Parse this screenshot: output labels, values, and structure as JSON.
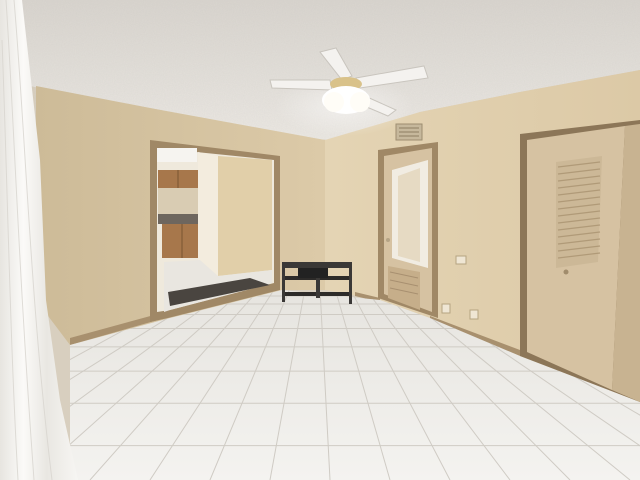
{
  "image": {
    "kind": "photograph",
    "subject": "empty bedroom",
    "elements": [
      "textured-ceiling",
      "ceiling-fan",
      "ceiling-air-vent",
      "curtain",
      "open-doorway-to-kitchen",
      "bathroom-door",
      "bi-fold-closet-doors",
      "tv-stand",
      "tile-floor",
      "floor-mat",
      "electrical-outlets",
      "light-switch"
    ]
  },
  "colors": {
    "ceiling": "#e6e2dc",
    "wall_left": "#d8c8a8",
    "wall_right": "#e3d2b2",
    "floor_tile": "#eceae6",
    "grout": "#cfcbc4",
    "door": "#d6c2a2",
    "door_frame": "#a08866",
    "baseboard": "#a8906e",
    "kitchen_cabinet": "#a7774b",
    "fan_blade": "#f4f2ef",
    "curtain": "#f2f0ec",
    "mat": "#4a4540",
    "stand_metal": "#3a3836"
  }
}
